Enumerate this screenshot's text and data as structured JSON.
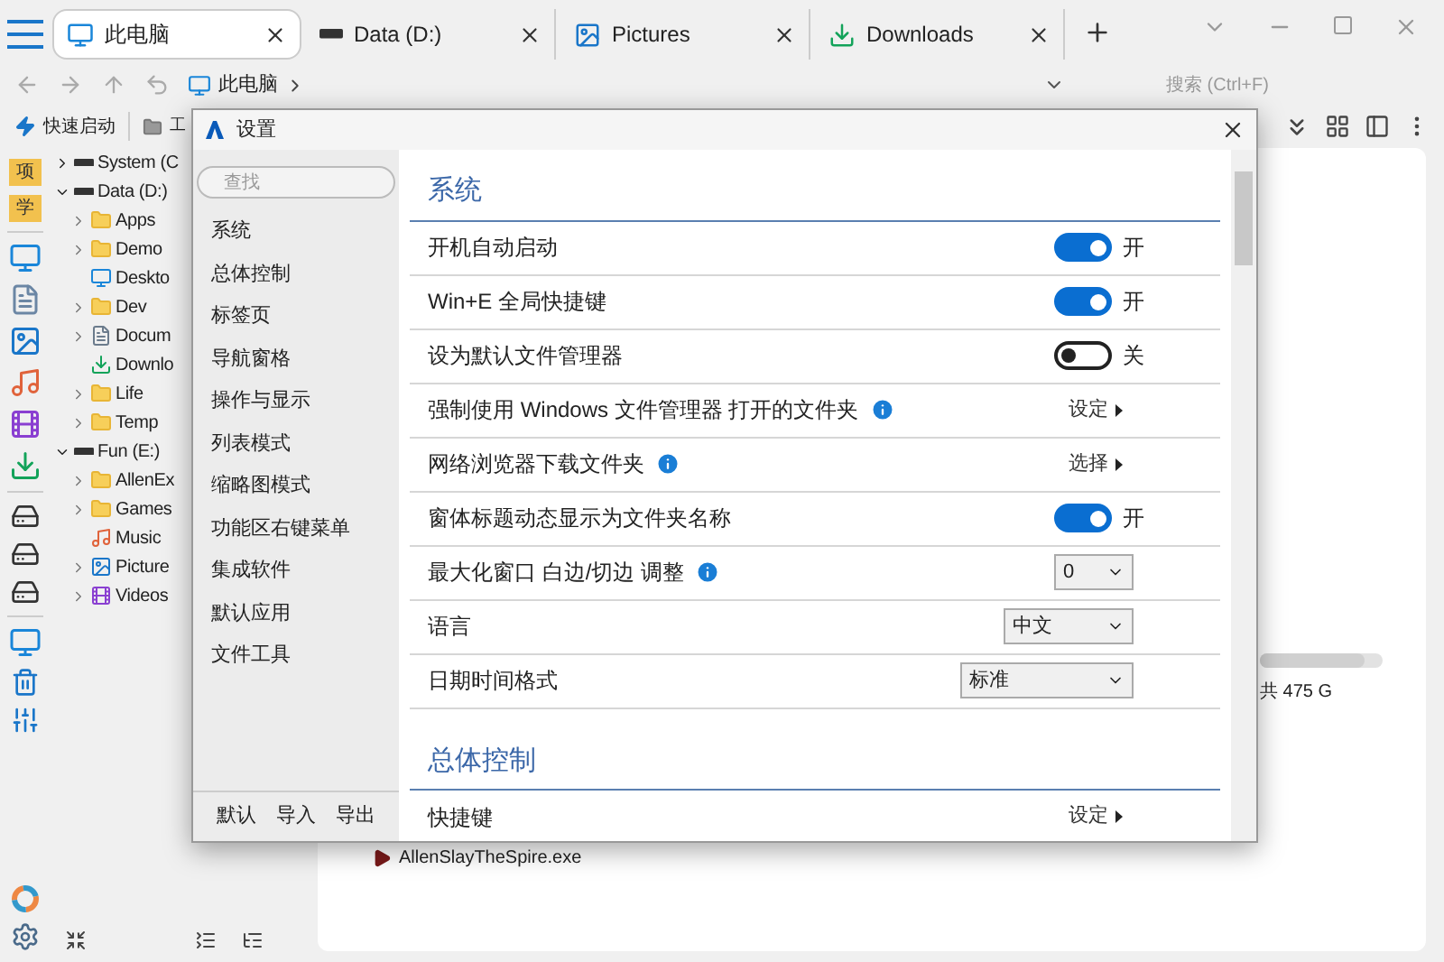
{
  "tabs": [
    {
      "label": "此电脑",
      "kind": "monitor",
      "selected": true
    },
    {
      "label": "Data (D:)",
      "kind": "drive",
      "selected": false
    },
    {
      "label": "Pictures",
      "kind": "picture",
      "selected": false
    },
    {
      "label": "Downloads",
      "kind": "download",
      "selected": false
    }
  ],
  "breadcrumb": "此电脑",
  "search": {
    "placeholder": "搜索 (Ctrl+F)"
  },
  "toolbar": {
    "items": [
      "快速启动",
      "工"
    ]
  },
  "quick_access": [
    {
      "label": "项"
    },
    {
      "label": "学"
    }
  ],
  "tree": [
    {
      "label": "System (C",
      "expanded": false
    },
    {
      "label": "Data (D:)",
      "expanded": true,
      "children": [
        {
          "label": "Apps",
          "kind": "folder",
          "expandable": true
        },
        {
          "label": "Demo",
          "kind": "folder",
          "expandable": true
        },
        {
          "label": "Deskto",
          "kind": "desktop",
          "expandable": false
        },
        {
          "label": "Dev",
          "kind": "folder",
          "expandable": true
        },
        {
          "label": "Docum",
          "kind": "document",
          "expandable": true
        },
        {
          "label": "Downlo",
          "kind": "download",
          "expandable": false
        },
        {
          "label": "Life",
          "kind": "folder",
          "expandable": true
        },
        {
          "label": "Temp",
          "kind": "folder",
          "expandable": true
        }
      ]
    },
    {
      "label": "Fun (E:)",
      "expanded": true,
      "children": [
        {
          "label": "AllenEx",
          "kind": "folder",
          "expandable": true
        },
        {
          "label": "Games",
          "kind": "folder",
          "expandable": true
        },
        {
          "label": "Music",
          "kind": "music",
          "expandable": false
        },
        {
          "label": "Picture",
          "kind": "picture",
          "expandable": true
        },
        {
          "label": "Videos",
          "kind": "video",
          "expandable": true
        }
      ]
    }
  ],
  "background_content": {
    "drive": {
      "usage": "共 475 G",
      "level": 0.85
    },
    "file": "AllenSlayTheSpire.exe"
  },
  "settings": {
    "title": "设置",
    "search_placeholder": "查找",
    "nav": [
      "系统",
      "总体控制",
      "标签页",
      "导航窗格",
      "操作与显示",
      "列表模式",
      "缩略图模式",
      "功能区右键菜单",
      "集成软件",
      "默认应用",
      "文件工具"
    ],
    "footer": [
      "默认",
      "导入",
      "导出"
    ],
    "sections": [
      {
        "title": "系统",
        "rows": [
          {
            "label": "开机自动启动",
            "kind": "toggle",
            "on": true,
            "value": "开",
            "info": false
          },
          {
            "label": "Win+E 全局快捷键",
            "kind": "toggle",
            "on": true,
            "value": "开",
            "info": false
          },
          {
            "label": "设为默认文件管理器",
            "kind": "toggle",
            "on": false,
            "value": "关",
            "info": false
          },
          {
            "label": "强制使用 Windows 文件管理器 打开的文件夹",
            "kind": "link",
            "value": "设定",
            "info": true
          },
          {
            "label": "网络浏览器下载文件夹",
            "kind": "link",
            "value": "选择",
            "info": true
          },
          {
            "label": "窗体标题动态显示为文件夹名称",
            "kind": "toggle",
            "on": true,
            "value": "开",
            "info": false
          },
          {
            "label": "最大化窗口 白边/切边 调整",
            "kind": "select",
            "value": "0",
            "info": true
          },
          {
            "label": "语言",
            "kind": "select",
            "value": "中文",
            "info": false
          },
          {
            "label": "日期时间格式",
            "kind": "select",
            "value": "标准",
            "info": false
          }
        ]
      },
      {
        "title": "总体控制",
        "rows": [
          {
            "label": "快捷键",
            "kind": "link",
            "value": "设定",
            "info": false
          }
        ]
      }
    ]
  }
}
